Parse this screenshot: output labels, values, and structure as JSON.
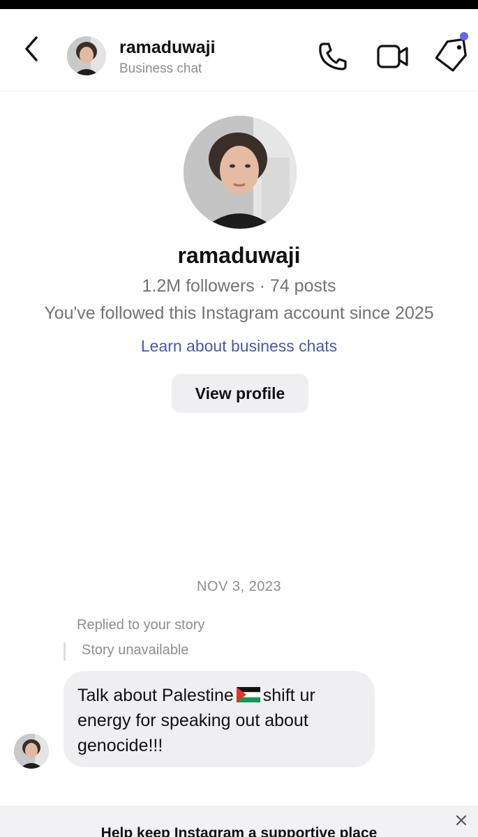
{
  "header": {
    "username": "ramaduwaji",
    "subtitle": "Business chat",
    "icons": [
      "back-arrow-icon",
      "phone-icon",
      "video-camera-icon",
      "tag-icon"
    ],
    "notification_dot_color": "#5b6bf0"
  },
  "profile": {
    "name": "ramaduwaji",
    "stats": "1.2M followers · 74 posts",
    "follow_info": "You've followed this Instagram account since 2025",
    "learn_link": "Learn about business chats",
    "view_profile_label": "View profile"
  },
  "thread": {
    "date": "NOV 3, 2023",
    "reply_context": "Replied to your story",
    "story_status": "Story unavailable",
    "message_line1_a": "Talk about Palestine",
    "message_line1_b": "shift ur",
    "message_line2": "energy for speaking out about",
    "message_line3": "genocide!!!",
    "flag_emoji": "palestine-flag"
  },
  "banner": {
    "text": "Help keep Instagram a supportive place"
  },
  "colors": {
    "link": "#4b56b3",
    "bubble": "#efeff2",
    "muted_text": "#8e8e93"
  }
}
